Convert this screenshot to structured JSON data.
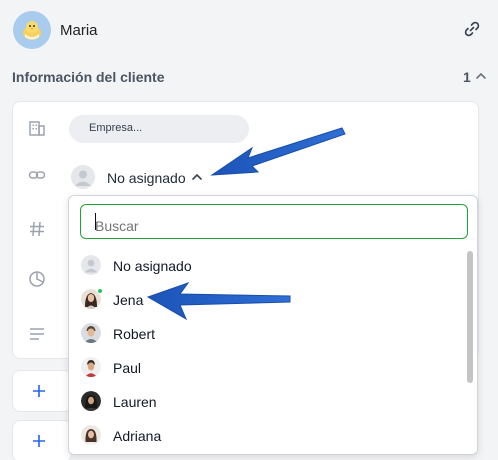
{
  "header": {
    "user_name": "Maria"
  },
  "section": {
    "title": "Información del cliente",
    "count": "1"
  },
  "company": {
    "placeholder": "Empresa..."
  },
  "assignee": {
    "label": "No asignado"
  },
  "dropdown": {
    "search_placeholder": "Buscar",
    "options": [
      {
        "label": "No asignado",
        "avatar": "default-user"
      },
      {
        "label": "Jena",
        "avatar": "photo",
        "online": true
      },
      {
        "label": "Robert",
        "avatar": "photo"
      },
      {
        "label": "Paul",
        "avatar": "photo"
      },
      {
        "label": "Lauren",
        "avatar": "photo"
      },
      {
        "label": "Adriana",
        "avatar": "photo"
      }
    ]
  },
  "colors": {
    "accent_green": "#22a33a",
    "arrow_blue": "#1f5fc8",
    "plus_blue": "#2563eb",
    "avatar_bg": "#a9cbee"
  }
}
